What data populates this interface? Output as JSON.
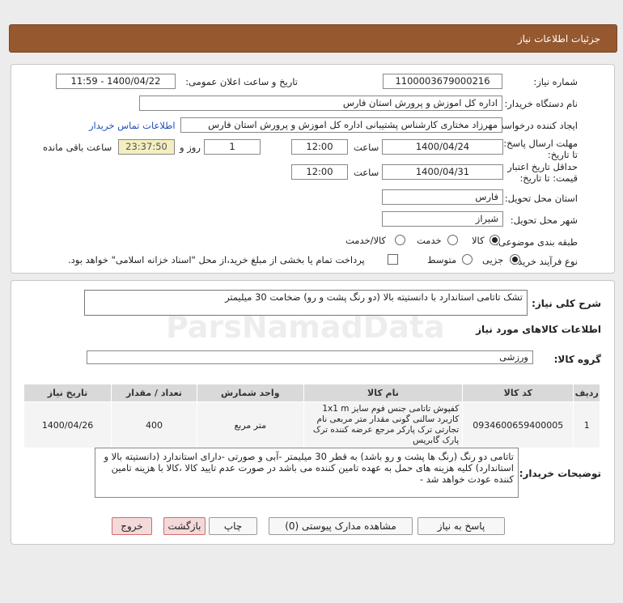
{
  "header": {
    "title": "جزئیات اطلاعات نیاز"
  },
  "info": {
    "need_number_label": "شماره نیاز:",
    "need_number": "1100003679000216",
    "announce_label": "تاریخ و ساعت اعلان عمومی:",
    "announce_value": "1400/04/22 - 11:59",
    "buyer_org_label": "نام دستگاه خریدار:",
    "buyer_org": "اداره کل اموزش و پرورش استان فارس",
    "requester_label": "ایجاد کننده درخواست:",
    "requester": "مهرزاد  مختاری  کارشناس پشتیبانی اداره کل اموزش و پرورش استان فارس",
    "contact_link": "اطلاعات تماس خریدار",
    "deadline_label": "مهلت ارسال پاسخ: تا تاریخ:",
    "deadline_date": "1400/04/24",
    "time_label": "ساعت",
    "deadline_time": "12:00",
    "days": "1",
    "days_label": "روز و",
    "remaining": "23:37:50",
    "remaining_label": "ساعت باقی مانده",
    "validity_label": "حداقل تاریخ اعتبار قیمت: تا تاریخ:",
    "validity_date": "1400/04/31",
    "validity_time": "12:00",
    "delivery_province_label": "استان محل تحویل:",
    "delivery_province": "فارس",
    "delivery_city_label": "شهر محل تحویل:",
    "delivery_city": "شیراز",
    "category_label": "طبقه بندی موضوعی:",
    "category_options": [
      "کالا",
      "خدمت",
      "کالا/خدمت"
    ],
    "process_label": "نوع فرآیند خرید :",
    "process_options": [
      "جزیی",
      "متوسط"
    ],
    "payment_note": "پرداخت تمام یا بخشی از مبلغ خرید،از محل \"اسناد خزانه اسلامی\" خواهد بود."
  },
  "details": {
    "summary_label": "شرح کلی نیاز:",
    "summary": "تشک تاتامی استاندارد با دانستیته بالا (دو رنگ پشت و رو) ضخامت 30 میلیمتر",
    "goods_title": "اطلاعات کالاهای مورد نیاز",
    "group_label": "گروه کالا:",
    "group": "ورزشی",
    "columns": [
      "ردیف",
      "کد کالا",
      "نام کالا",
      "واحد شمارش",
      "تعداد / مقدار",
      "تاریخ نیاز"
    ],
    "rows": [
      {
        "row": "1",
        "code": "0934600659400005",
        "name": "کفپوش تاتامی جنس فوم سایز 1x1 m کاربرد سالنی گونی مقدار متر مربعی نام تجارتی ترک پارکر مرجع عرضه کننده ترک پارک گابریس",
        "unit": "متر مربع",
        "qty": "400",
        "date": "1400/04/26"
      }
    ],
    "buyer_desc_label": "توضیحات خریدار:",
    "buyer_desc": "تاتامی دو رنگ (رنگ ها پشت و رو باشد) به قطر 30 میلیمتر -آبی و صورتی -دارای استاندارد (دانستیته بالا و استاندارد) کلیه هزینه های حمل به عهده تامین کننده می باشد در صورت عدم تایید کالا ،کالا با هزینه تامین کننده عودت خواهد شد -"
  },
  "buttons": {
    "reply": "پاسخ به نیاز",
    "attachments": "مشاهده مدارک پیوستی (0)",
    "print": "چاپ",
    "back": "بازگشت",
    "exit": "خروج"
  }
}
